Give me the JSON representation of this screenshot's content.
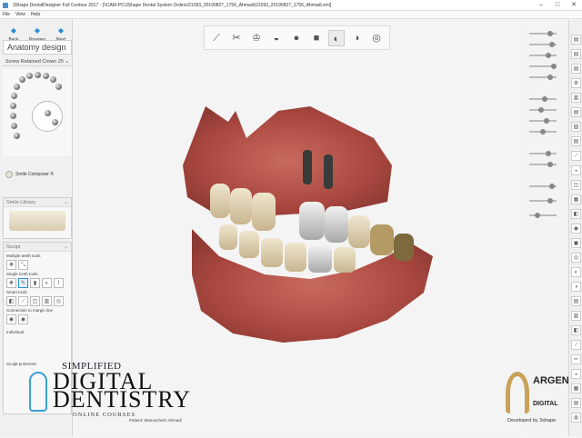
{
  "window": {
    "title": "3Shape DentalDesigner Full Contour 2017 - [\\\\CAM-PC\\3Shape Dental System Orders\\21093_20190827_1756_Ahmadi\\21093_20190827_1756_Ahmadi.xml]",
    "minimize": "–",
    "maximize": "□",
    "close": "✕"
  },
  "menu": [
    "File",
    "View",
    "Help"
  ],
  "nav": {
    "back": "Back",
    "preview": "Preview",
    "next": "Next"
  },
  "sidebar": {
    "title": "Anatomy design",
    "restoration": "Screw Retained Crown 25",
    "smile_composer": "Smile Composer ®",
    "smile_library": "Smile Library",
    "sculpt": "Sculpt",
    "multi_teeth_tools": "Multiple teeth tools",
    "single_tooth_tools": "Single tooth tools",
    "smart_tools": "Smart tools",
    "connection_margin": "Connection to margin line",
    "individual": "Individual",
    "sculpt_protected": "Sculpt protected"
  },
  "watermark": {
    "line1": "SIMPLIFIED",
    "line2": "DIGITAL",
    "line3": "DENTISTRY",
    "line4": "ONLINE COURSES"
  },
  "patient": {
    "label": "Patient:",
    "name": "Manouchehr Ahmadi"
  },
  "branding": {
    "argen": "ARGEN",
    "digital": "DIGITAL",
    "developed_by": "Developed by 3shape"
  },
  "colors": {
    "accent": "#2a8fd6",
    "gum": "#b4524c",
    "tooth": "#e7dcc2",
    "crown": "#d9d9d9",
    "abutment": "#3a3a3a",
    "argen_gold": "#c9a25a"
  },
  "icons": {
    "back": "arrow-left-icon",
    "preview": "eye-icon",
    "next": "arrow-right-icon"
  }
}
